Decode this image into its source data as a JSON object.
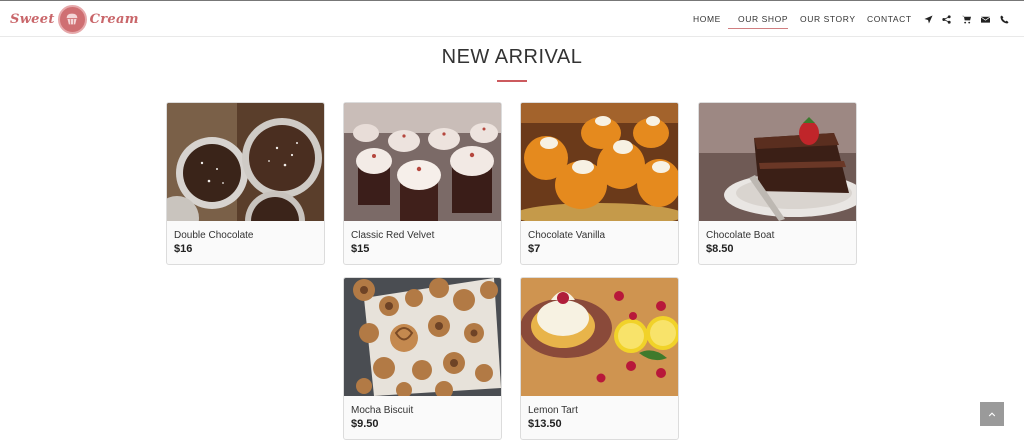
{
  "brand": {
    "name_left": "Sweet",
    "name_right": "Cream",
    "logo_icon": "cupcake-icon"
  },
  "nav": {
    "items": [
      {
        "label": "HOME"
      },
      {
        "label": "OUR SHOP"
      },
      {
        "label": "OUR STORY"
      },
      {
        "label": "CONTACT"
      }
    ],
    "active": "OUR SHOP",
    "icons": [
      "location-arrow-icon",
      "share-icon",
      "cart-icon",
      "mail-icon",
      "phone-icon"
    ]
  },
  "section": {
    "title": "NEW ARRIVAL",
    "accent_color": "#cc5a5e"
  },
  "products": [
    {
      "name": "Double Chocolate",
      "price": "$16"
    },
    {
      "name": "Classic Red Velvet",
      "price": "$15"
    },
    {
      "name": "Chocolate Vanilla",
      "price": "$7"
    },
    {
      "name": "Chocolate Boat",
      "price": "$8.50"
    },
    {
      "name": "Mocha Biscuit",
      "price": "$9.50"
    },
    {
      "name": "Lemon Tart",
      "price": "$13.50"
    }
  ],
  "back_to_top_icon": "chevron-up-icon"
}
